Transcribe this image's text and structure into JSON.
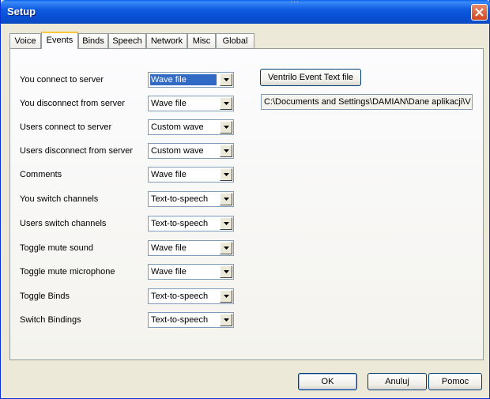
{
  "window": {
    "title": "Setup"
  },
  "tabs": [
    {
      "label": "Voice",
      "active": false
    },
    {
      "label": "Events",
      "active": true
    },
    {
      "label": "Binds",
      "active": false
    },
    {
      "label": "Speech",
      "active": false
    },
    {
      "label": "Network",
      "active": false
    },
    {
      "label": "Misc",
      "active": false
    },
    {
      "label": "Global",
      "active": false
    }
  ],
  "events": [
    {
      "label": "You connect to server",
      "value": "Wave file"
    },
    {
      "label": "You disconnect from server",
      "value": "Wave file"
    },
    {
      "label": "Users connect to server",
      "value": "Custom wave"
    },
    {
      "label": "Users disconnect from server",
      "value": "Custom wave"
    },
    {
      "label": "Comments",
      "value": "Wave file"
    },
    {
      "label": "You switch channels",
      "value": "Text-to-speech"
    },
    {
      "label": "Users switch channels",
      "value": "Text-to-speech"
    },
    {
      "label": "Toggle mute sound",
      "value": "Wave file"
    },
    {
      "label": "Toggle mute microphone",
      "value": "Wave file"
    },
    {
      "label": "Toggle Binds",
      "value": "Text-to-speech"
    },
    {
      "label": "Switch Bindings",
      "value": "Text-to-speech"
    }
  ],
  "event_text_file": {
    "button_label": "Ventrilo Event Text file",
    "path": "C:\\Documents and Settings\\DAMIAN\\Dane aplikacji\\V"
  },
  "footer": {
    "ok_label": "OK",
    "cancel_label": "Anuluj",
    "help_label": "Pomoc"
  },
  "colors": {
    "titlebar": "#0a53d8",
    "dialog_bg": "#ece9d8",
    "selection": "#316ac5",
    "close_button": "#d2461f"
  }
}
